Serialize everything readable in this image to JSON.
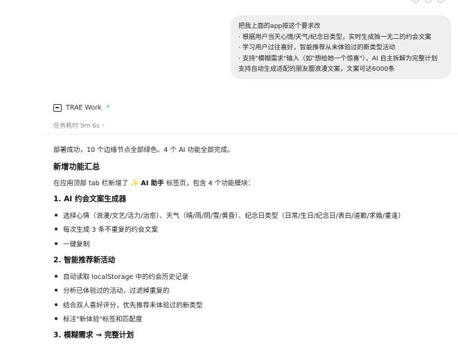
{
  "user_message": {
    "lines": [
      "把我上面的app按这个要求改",
      "· 根据用户当天心情/天气/纪念日类型，实时生成独一无二的约会文案",
      "· 学习用户过往喜好，智能推荐从未体验过的新类型活动",
      "· 支持\"模糊需求\"输入（如\"想给她一个惊喜\"），AI 自主拆解为完整计划",
      "支持自动生成适配的朋友圈浪漫文案，文案可达6000条"
    ]
  },
  "agent": {
    "name": "TRAE Work",
    "duration": "任务耗时 9m 6s"
  },
  "response": {
    "summary": "部署成功，10 个边缘节点全部绿色。4 个 AI 功能全部完成。",
    "section_title": "新增功能汇总",
    "intro_prefix": "在应用顶部 tab 栏新增了",
    "intro_sparkle": "✨",
    "intro_tab_name": "AI 助手",
    "intro_suffix": "标签页，包含 4 个功能模块：",
    "modules": [
      {
        "title": "1. AI 约会文案生成器",
        "items": [
          "选择心情（浪漫/文艺/活力/治愈）、天气（晴/雨/阴/雪/黄昏）、纪念日类型（日常/生日/纪念日/表白/道歉/求婚/重逢）",
          "每次生成 3 条不重复的约会文案",
          "一键复制"
        ]
      },
      {
        "title": "2. 智能推荐新活动",
        "items": [
          "自动读取 localStorage 中的约会历史记录",
          "分析已体验过的活动，过滤掉重复的",
          "结合双人喜好评分，优先推荐未体验过的新类型",
          "标注\"新体验\"标签和匹配度"
        ]
      },
      {
        "title": "3. 模糊需求 → 完整计划",
        "items": []
      }
    ]
  }
}
